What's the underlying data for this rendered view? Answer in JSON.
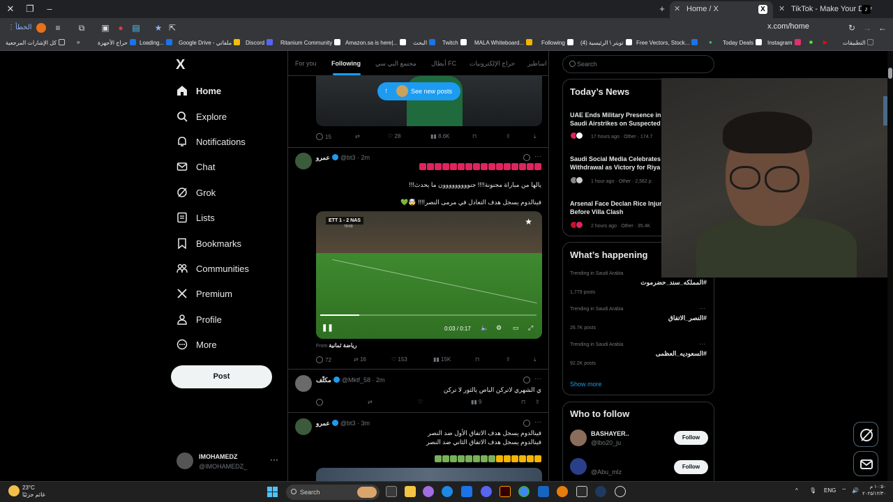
{
  "browser": {
    "tabs": [
      {
        "label": "Home / X",
        "active": true
      },
      {
        "label": "TikTok - Make Your Day",
        "active": false
      }
    ],
    "url": "x.com/home",
    "error_button": "الخطأ",
    "bookmarks": [
      "كل الإشارات المرجعية",
      "حراج الأجهزة",
      "Loading...",
      "Google Drive - ملفاتي",
      "Discord",
      "Ritanium Community",
      "Amazon.sa is here|...",
      "البحث",
      "Twitch",
      "MALA Whiteboard...",
      "Following",
      "(4) تويتر \\ الرئيسية",
      "Free Vectors, Stock...",
      "Today Deals",
      "Instagram",
      "التطبيقات"
    ]
  },
  "nav": {
    "logo": "X",
    "items": [
      {
        "label": "Home",
        "icon": "home-icon"
      },
      {
        "label": "Explore",
        "icon": "search-icon"
      },
      {
        "label": "Notifications",
        "icon": "bell-icon"
      },
      {
        "label": "Chat",
        "icon": "mail-icon"
      },
      {
        "label": "Grok",
        "icon": "grok-icon"
      },
      {
        "label": "Lists",
        "icon": "list-icon"
      },
      {
        "label": "Bookmarks",
        "icon": "bookmark-icon"
      },
      {
        "label": "Communities",
        "icon": "people-icon"
      },
      {
        "label": "Premium",
        "icon": "x-icon"
      },
      {
        "label": "Profile",
        "icon": "person-icon"
      },
      {
        "label": "More",
        "icon": "more-circle-icon"
      }
    ],
    "post_button": "Post",
    "account": {
      "name": "IMOHAMEDZ",
      "handle": "@IMOHAMEDZ_",
      "more": "···"
    }
  },
  "feed": {
    "tabs": [
      "For you",
      "Following",
      "مجتمع البي سي",
      "أبطال FC",
      "حراج الإلكترونيات",
      "اساطير"
    ],
    "new_posts": "See new posts",
    "first_actions": {
      "replies": "15",
      "likes": "28",
      "views": "8.6K"
    },
    "tweet1": {
      "name": "عمرو",
      "handle": "@bt3",
      "time": "2m",
      "line2": "يالها من مباراة مجنونة!!!! جنووووووووون ما يحدث!!!",
      "line3": "فينالدوم يسجل هدف التعادل في مرمى النصر!!!! 🤯💚",
      "video_score": "ETT 1 - 2 NAS",
      "video_minute": "79:03",
      "video_time": "0:03 / 0:17",
      "video_progress": 0.18,
      "from_label": "From",
      "from_name": "رياضة ثمانية",
      "actions": {
        "replies": "72",
        "reposts": "16",
        "likes": "153",
        "views": "15K"
      }
    },
    "tweet2": {
      "name": "مكثّف",
      "handle": "@Mktf_58",
      "time": "2m",
      "text": "ي الشهري لاتركن الباص يالثور لا تركن",
      "actions": {
        "views": "9"
      }
    },
    "tweet3": {
      "name": "عمرو",
      "handle": "@bt3",
      "time": "3m",
      "line1": "فينالدوم يسجل هدف الاتفاق الأول ضد النصر",
      "line2": "فينالدوم يسجل هدف الاتفاق الثاني ضد النصر"
    }
  },
  "right": {
    "search_placeholder": "Search",
    "todays_news": {
      "title": "Today’s News",
      "items": [
        {
          "title1": "UAE Ends Military Presence in",
          "title2": "Saudi Airstrikes on Suspected",
          "meta": "17 hours ago · Other · 174.7"
        },
        {
          "title1": "Saudi Social Media Celebrates",
          "title2": "Withdrawal as Victory for Riya",
          "meta": "1 hour ago · Other · 2,562 p"
        },
        {
          "title1": "Arsenal Face Declan Rice Injur",
          "title2": "Before Villa Clash",
          "meta": "2 hours ago · Other · 35.4K"
        }
      ]
    },
    "whats_happening": {
      "title": "What’s happening",
      "trends": [
        {
          "context": "Trending in Saudi Arabia",
          "tag": "#المملكه_سند_حضرموت",
          "count": "1,779 posts"
        },
        {
          "context": "Trending in Saudi Arabia",
          "tag": "#النصر_الاتفاق",
          "count": "26.7K posts"
        },
        {
          "context": "Trending in Saudi Arabia",
          "tag": "#السعوديه_العظمى",
          "count": "92.2K posts"
        }
      ],
      "show_more": "Show more"
    },
    "who_to_follow": {
      "title": "Who to follow",
      "users": [
        {
          "name": "BASHAYER..",
          "handle": "@lbo20_ju",
          "button": "Follow"
        },
        {
          "name": "",
          "handle": "@Abu_mlz",
          "button": "Follow"
        }
      ]
    }
  },
  "taskbar": {
    "temperature": "23°C",
    "weather_text": "غائم جزئيًا",
    "search": "Search",
    "lang": "ENG",
    "time": "١٠:٥٠ م",
    "date": "٢٠٢٥/١٢/٣٠"
  },
  "colors": {
    "accent": "#1d9bf0",
    "background": "#000000",
    "border": "#2f3336",
    "muted": "#71767b"
  }
}
